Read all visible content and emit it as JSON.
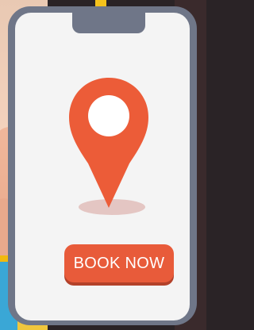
{
  "colors": {
    "phone_frame": "#6f7688",
    "screen_background": "#f4f4f4",
    "pin": "#ec5c38",
    "pin_hole": "#ffffff",
    "button": "#e85b3a",
    "button_shadow": "#b3412a",
    "button_text": "#ffffff"
  },
  "icons": {
    "pin": "location-pin-icon"
  },
  "button": {
    "label": "BOOK NOW"
  }
}
